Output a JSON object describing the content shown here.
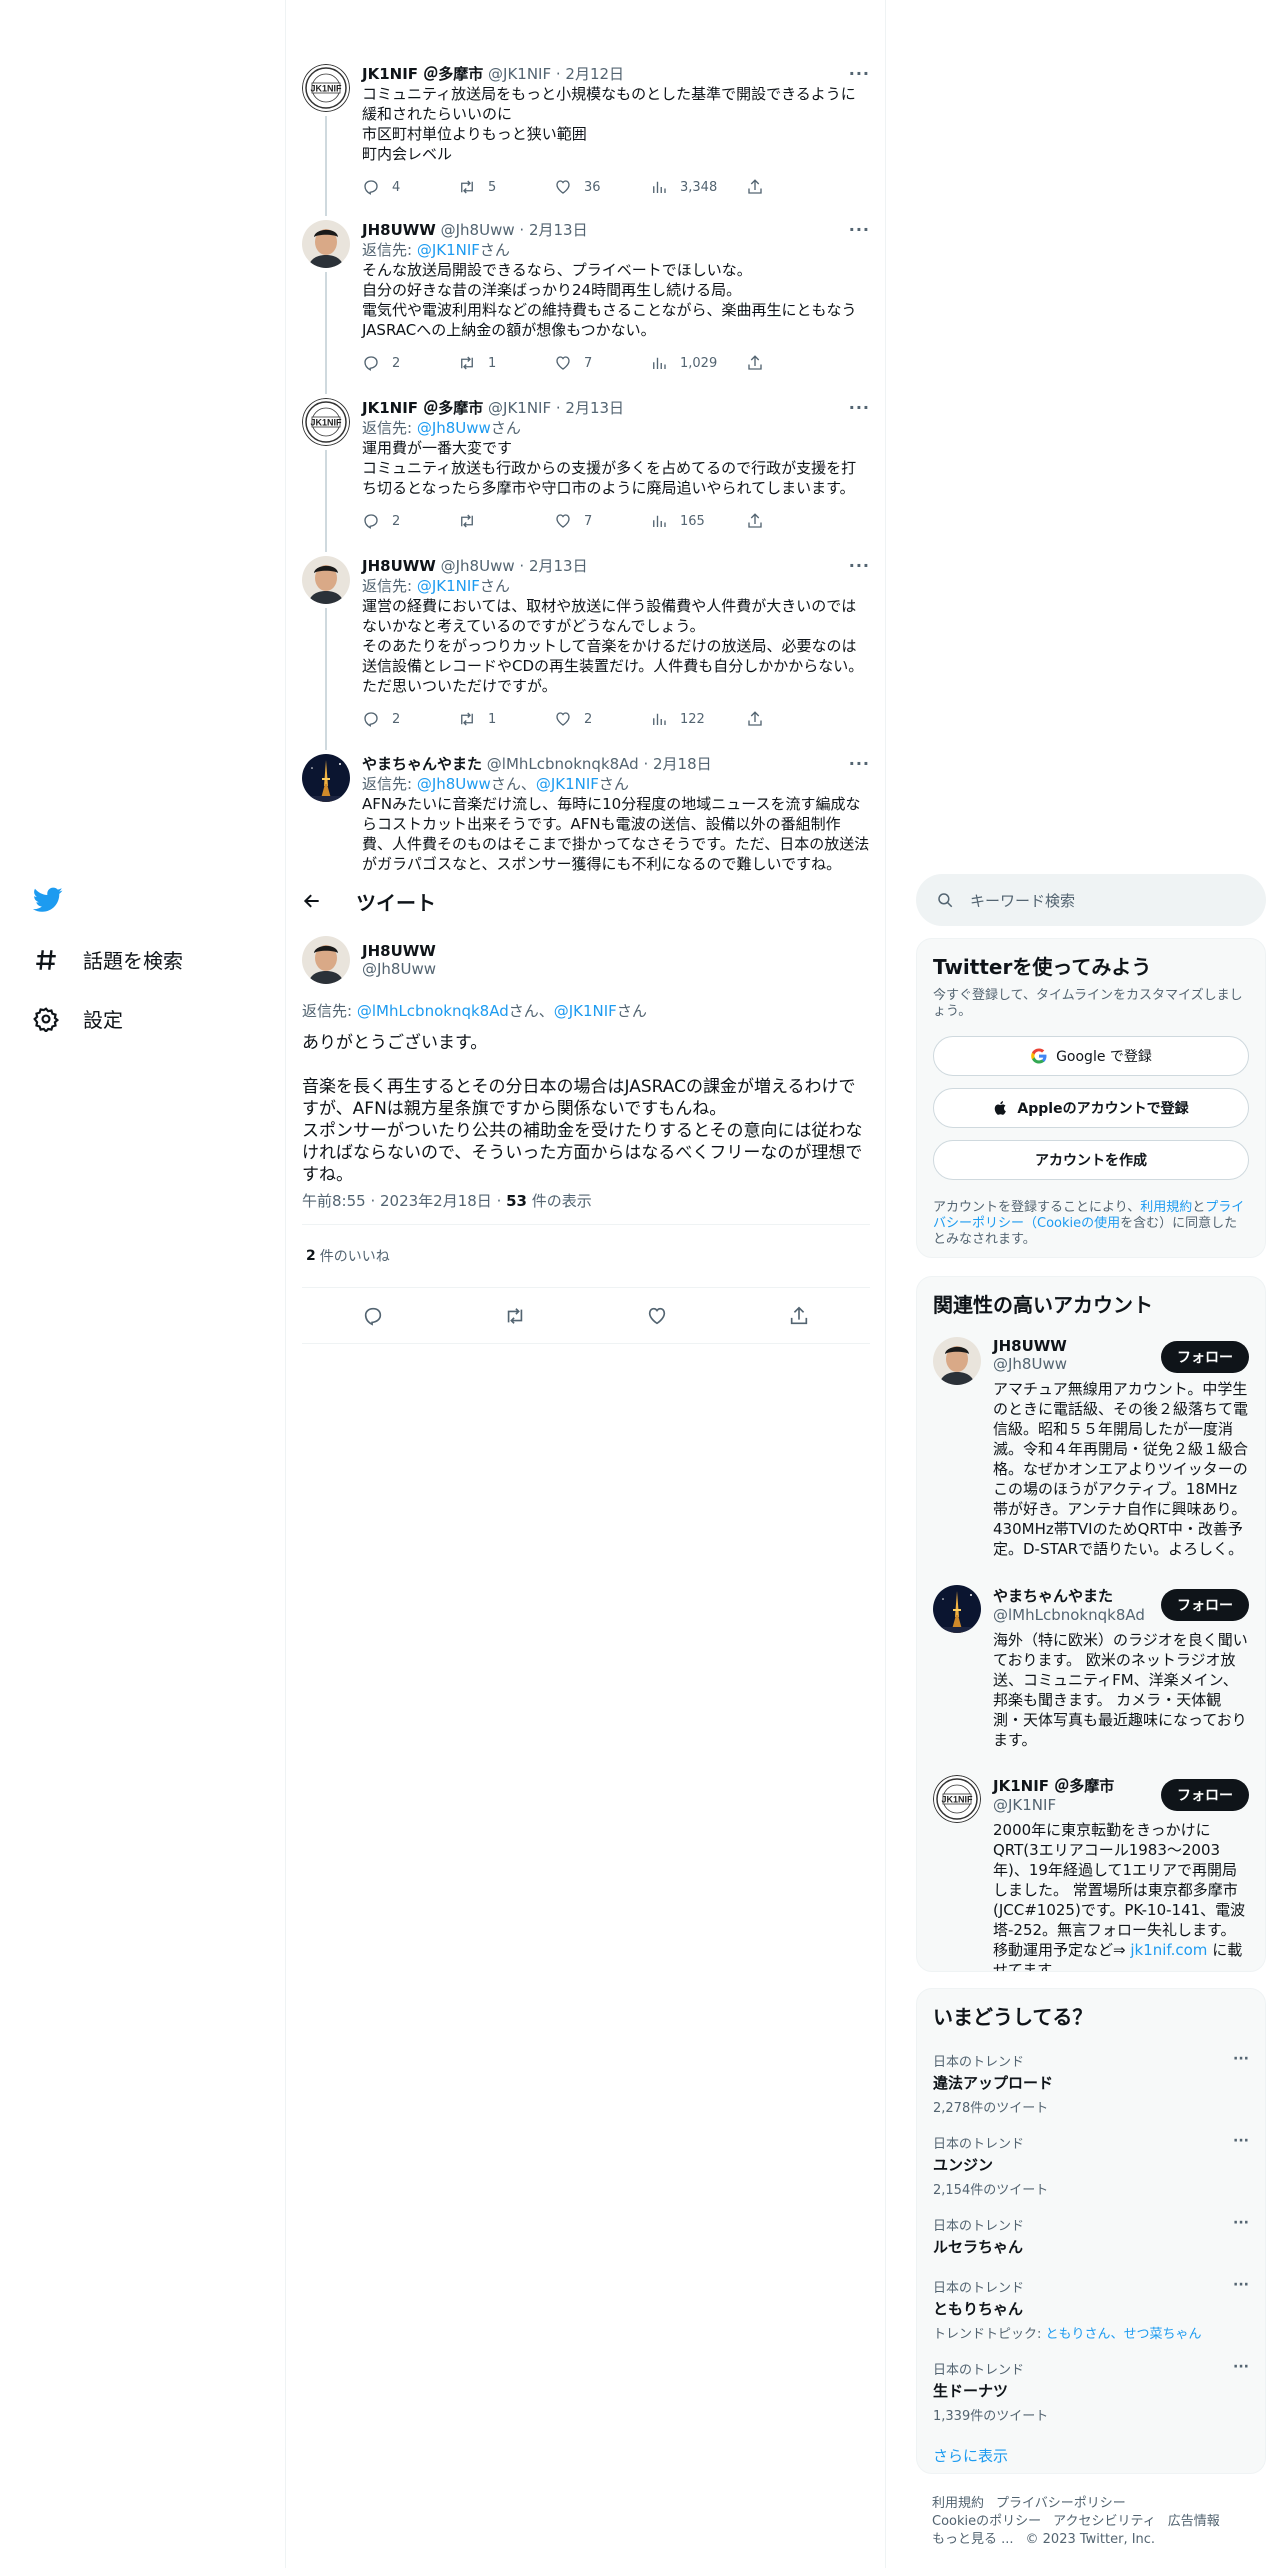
{
  "nav": {
    "search_label": "話題を検索",
    "settings_label": "設定"
  },
  "thread": [
    {
      "name": "JK1NIF ＠多摩市",
      "handle": "@JK1NIF",
      "date": "2月12日",
      "avatar": "badge",
      "reply_to": [],
      "text": "コミュニティ放送局をもっと小規模なものとした基準で開設できるように緩和されたらいいのに\n市区町村単位よりもっと狭い範囲\n町内会レベル",
      "replies": "4",
      "retweets": "5",
      "likes": "36",
      "views": "3,348"
    },
    {
      "name": "JH8UWW",
      "handle": "@Jh8Uww",
      "date": "2月13日",
      "avatar": "person",
      "reply_to": [
        "@JK1NIF"
      ],
      "text": "そんな放送局開設できるなら、プライベートでほしいな。\n自分の好きな昔の洋楽ばっかり24時間再生し続ける局。\n電気代や電波利用料などの維持費もさることながら、楽曲再生にともなうJASRACへの上納金の額が想像もつかない。",
      "replies": "2",
      "retweets": "1",
      "likes": "7",
      "views": "1,029"
    },
    {
      "name": "JK1NIF ＠多摩市",
      "handle": "@JK1NIF",
      "date": "2月13日",
      "avatar": "badge",
      "reply_to": [
        "@Jh8Uww"
      ],
      "text": "運用費が一番大変です\nコミュニティ放送も行政からの支援が多くを占めてるので行政が支援を打ち切るとなったら多摩市や守口市のように廃局追いやられてしまいます。",
      "replies": "2",
      "retweets": "",
      "likes": "7",
      "views": "165"
    },
    {
      "name": "JH8UWW",
      "handle": "@Jh8Uww",
      "date": "2月13日",
      "avatar": "person",
      "reply_to": [
        "@JK1NIF"
      ],
      "text": "運営の経費においては、取材や放送に伴う設備費や人件費が大きいのではないかなと考えているのですがどうなんでしょう。\nそのあたりをがっつりカットして音楽をかけるだけの放送局、必要なのは送信設備とレコードやCDの再生装置だけ。人件費も自分しかかからない。ただ思いついただけですが。",
      "replies": "2",
      "retweets": "1",
      "likes": "2",
      "views": "122"
    },
    {
      "name": "やまちゃんやまた",
      "handle": "@lMhLcbnoknqk8Ad",
      "date": "2月18日",
      "avatar": "tower",
      "reply_to": [
        "@Jh8Uww",
        "@JK1NIF"
      ],
      "text": "AFNみたいに音楽だけ流し、毎時に10分程度の地域ニュースを流す編成ならコストカット出来そうです。AFNも電波の送信、設備以外の番組制作費、人件費そのものはそこまで掛かってなさそうです。ただ、日本の放送法がガラパゴスなと、スポンサー獲得にも不利になるので難しいですね。",
      "replies": "",
      "retweets": "",
      "likes": "",
      "views": ""
    }
  ],
  "focus": {
    "header_title": "ツイート",
    "name": "JH8UWW",
    "handle": "@Jh8Uww",
    "reply_prefix": "返信先: ",
    "reply_to_1": "@lMhLcbnoknqk8Ad",
    "reply_sep": "さん、",
    "reply_to_2": "@JK1NIF",
    "reply_suffix": "さん",
    "text": "ありがとうございます。\n\n音楽を長く再生するとその分日本の場合はJASRACの課金が増えるわけですが、AFNは親方星条旗ですから関係ないですもんね。\nスポンサーがついたり公共の補助金を受けたりするとその意向には従わなければならないので、そういった方面からはなるべくフリーなのが理想ですね。",
    "time": "午前8:55",
    "date": "2023年2月18日",
    "views_count": "53",
    "views_label": " 件の表示",
    "likes_count": "2",
    "likes_label": "件のいいね"
  },
  "right": {
    "search_placeholder": "キーワード検索",
    "signup": {
      "title": "Twitterを使ってみよう",
      "subtitle": "今すぐ登録して、タイムラインをカスタマイズしましょう。",
      "google_btn": "Google で登録",
      "apple_btn": "Appleのアカウントで登録",
      "create_btn": "アカウントを作成",
      "terms_1": "アカウントを登録することにより、",
      "terms_link1": "利用規約",
      "terms_2": "と",
      "terms_link2": "プライバシーポリシー（Cookieの使用",
      "terms_3": "を含む）に同意したとみなされます。"
    },
    "related": {
      "title": "関連性の高いアカウント",
      "follow_label": "フォロー",
      "accounts": [
        {
          "name": "JH8UWW",
          "handle": "@Jh8Uww",
          "avatar": "person",
          "bio": "アマチュア無線用アカウント。中学生のときに電話級、その後２級落ちて電信級。昭和５５年開局したが一度消滅。令和４年再開局・従免２級１級合格。なぜかオンエアよりツイッターのこの場のほうがアクティブ。18MHz帯が好き。アンテナ自作に興味あり。430MHz帯TVIのためQRT中・改善予定。D-STARで語りたい。よろしく。",
          "link": ""
        },
        {
          "name": "やまちゃんやまた",
          "handle": "@lMhLcbnoknqk8Ad",
          "avatar": "tower",
          "bio": "海外（特に欧米）のラジオを良く聞いております。 欧米のネットラジオ放送、コミュニティFM、洋楽メイン、邦楽も聞きます。 カメラ・天体観測・天体写真も最近趣味になっております。",
          "link": ""
        },
        {
          "name": "JK1NIF ＠多摩市",
          "handle": "@JK1NIF",
          "avatar": "badge",
          "bio": "2000年に東京転勤をきっかけにQRT(3エリアコール1983～2003年)、19年経過して1エリアで再開局しました。 常置場所は東京都多摩市(JCC#1025)です。PK-10-141、電波塔-252。無言フォロー失礼します。移動運用予定など⇒ ",
          "link": "jk1nif.com",
          "bio_after": " に載せてます。"
        }
      ]
    },
    "trends": {
      "title": "いまどうしてる？",
      "items": [
        {
          "category": "日本のトレンド",
          "name": "違法アップロード",
          "count": "2,278件のツイート",
          "topic_label": "",
          "topic_links": ""
        },
        {
          "category": "日本のトレンド",
          "name": "ユンジン",
          "count": "2,154件のツイート",
          "topic_label": "",
          "topic_links": ""
        },
        {
          "category": "日本のトレンド",
          "name": "ルセラちゃん",
          "count": "",
          "topic_label": "",
          "topic_links": ""
        },
        {
          "category": "日本のトレンド",
          "name": "ともりちゃん",
          "count": "",
          "topic_label": "トレンドトピック: ",
          "topic_links": "ともりさん、せつ菜ちゃん"
        },
        {
          "category": "日本のトレンド",
          "name": "生ドーナツ",
          "count": "1,339件のツイート",
          "topic_label": "",
          "topic_links": ""
        }
      ],
      "show_more": "さらに表示"
    },
    "footer": {
      "links": [
        "利用規約",
        "プライバシーポリシー",
        "Cookieのポリシー",
        "アクセシビリティ",
        "広告情報",
        "もっと見る ..."
      ],
      "copyright": "© 2023 Twitter, Inc."
    }
  }
}
